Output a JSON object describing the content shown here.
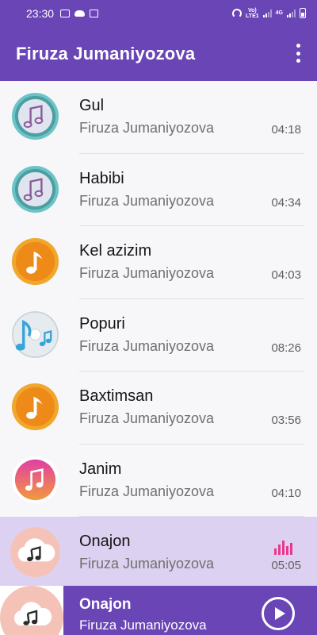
{
  "status_bar": {
    "time": "23:30",
    "network_label_top": "Vo)",
    "network_label_bottom": "LTE1",
    "data_label": "4G",
    "icons": [
      "screen-icon",
      "cloud-icon",
      "image-icon",
      "hotspot-icon",
      "signal-icon",
      "battery-icon"
    ]
  },
  "app_bar": {
    "title": "Firuza Jumaniyozova",
    "menu_icon": "more-vert-icon"
  },
  "songs": [
    {
      "title": "Gul",
      "artist": "Firuza Jumaniyozova",
      "duration": "04:18",
      "art": "teal-note-disc-icon",
      "playing": false
    },
    {
      "title": "Habibi",
      "artist": "Firuza Jumaniyozova",
      "duration": "04:34",
      "art": "teal-note-disc-icon",
      "playing": false
    },
    {
      "title": "Kel azizim",
      "artist": "Firuza Jumaniyozova",
      "duration": "04:03",
      "art": "orange-note-disc-icon",
      "playing": false
    },
    {
      "title": "Popuri",
      "artist": "Firuza Jumaniyozova",
      "duration": "08:26",
      "art": "blue-notes-cd-icon",
      "playing": false
    },
    {
      "title": "Baxtimsan",
      "artist": "Firuza Jumaniyozova",
      "duration": "03:56",
      "art": "orange-note-disc-icon",
      "playing": false
    },
    {
      "title": "Janim",
      "artist": "Firuza Jumaniyozova",
      "duration": "04:10",
      "art": "pink-note-disc-icon",
      "playing": false
    },
    {
      "title": "Onajon",
      "artist": "Firuza Jumaniyozova",
      "duration": "05:05",
      "art": "cloud-note-icon",
      "playing": true
    }
  ],
  "now_playing": {
    "title": "Onajon",
    "artist": "Firuza Jumaniyozova",
    "art": "cloud-note-icon",
    "control": "play-icon"
  },
  "colors": {
    "primary": "#6a45b6",
    "active_row": "#dcd1f0",
    "equalizer": "#e8388a"
  }
}
